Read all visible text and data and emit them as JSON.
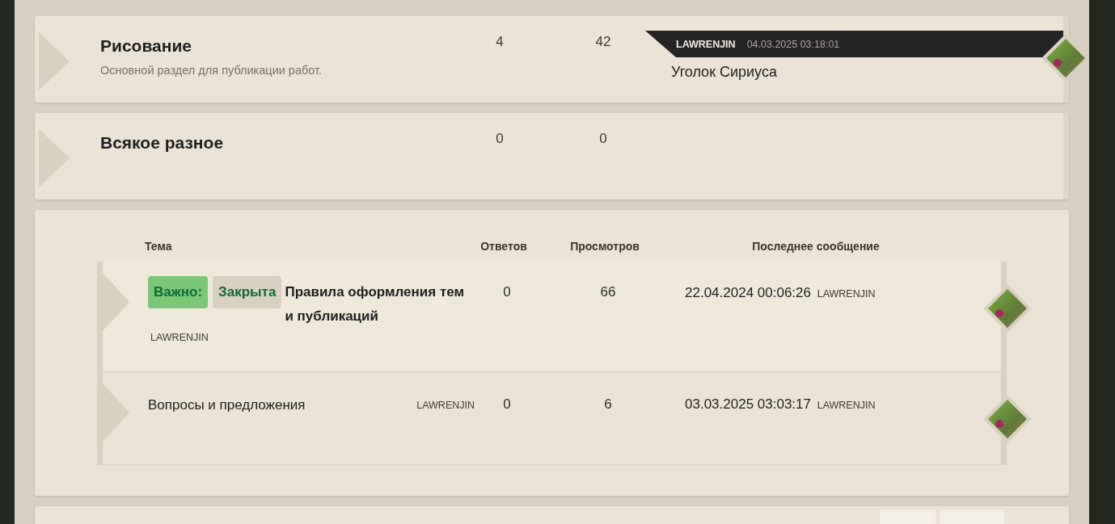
{
  "forums": [
    {
      "title": "Рисование",
      "description": "Основной раздел для публикации работ.",
      "topics": "4",
      "posts": "42",
      "last_post": {
        "author": "LAWRENJIN",
        "date": "04.03.2025 03:18:01",
        "topic": "Уголок Сириуса"
      }
    },
    {
      "title": "Всякое разное",
      "topics": "0",
      "posts": "0"
    }
  ],
  "topics_table": {
    "columns": [
      "Тема",
      "Ответов",
      "Просмотров",
      "Последнее сообщение"
    ],
    "rows": [
      {
        "labels": [
          {
            "text": "Важно:",
            "kind": "important"
          },
          {
            "text": "Закрыта",
            "kind": "closed"
          }
        ],
        "title": "Правила оформления тем и публикаций",
        "sticky": true,
        "author": "LAWRENJIN",
        "replies": "0",
        "views": "66",
        "last_date": "22.04.2024 00:06:26",
        "last_author": "LAWRENJIN"
      },
      {
        "labels": [],
        "title": "Вопросы и предложения",
        "sticky": false,
        "author": "LAWRENJIN",
        "replies": "0",
        "views": "6",
        "last_date": "03.03.2025 03:03:17",
        "last_author": "LAWRENJIN"
      }
    ]
  }
}
